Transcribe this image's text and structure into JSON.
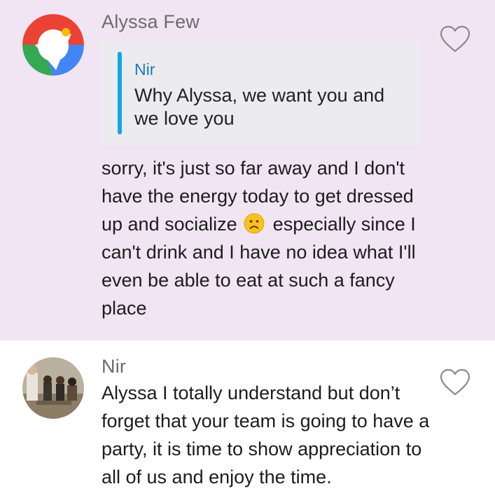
{
  "comments": [
    {
      "author": "Alyssa Few",
      "avatar": "google-pin-style-icon",
      "quote": {
        "author": "Nir",
        "text": "Why Alyssa, we want you and we love you"
      },
      "text_before_emoji": "sorry, it's just so far away and I don't have the energy today to get dressed up and socialize",
      "emoji": "frowning-face-emoji",
      "text_after_emoji": "especially since I can't drink and I have no idea what I'll even be able to eat at such a fancy place",
      "like_icon": "heart-outline-icon",
      "highlight_color": "#f1e4f3"
    },
    {
      "author": "Nir",
      "avatar": "photo-avatar",
      "text": "Alyssa I totally understand but don’t forget that your team is going to have a party, it is time to show appreciation to all of us and enjoy the time.",
      "like_icon": "heart-outline-icon"
    }
  ],
  "colors": {
    "quote_bar": "#10a7e8",
    "quote_author": "#1a7fb0",
    "author": "#6b6b6b"
  }
}
